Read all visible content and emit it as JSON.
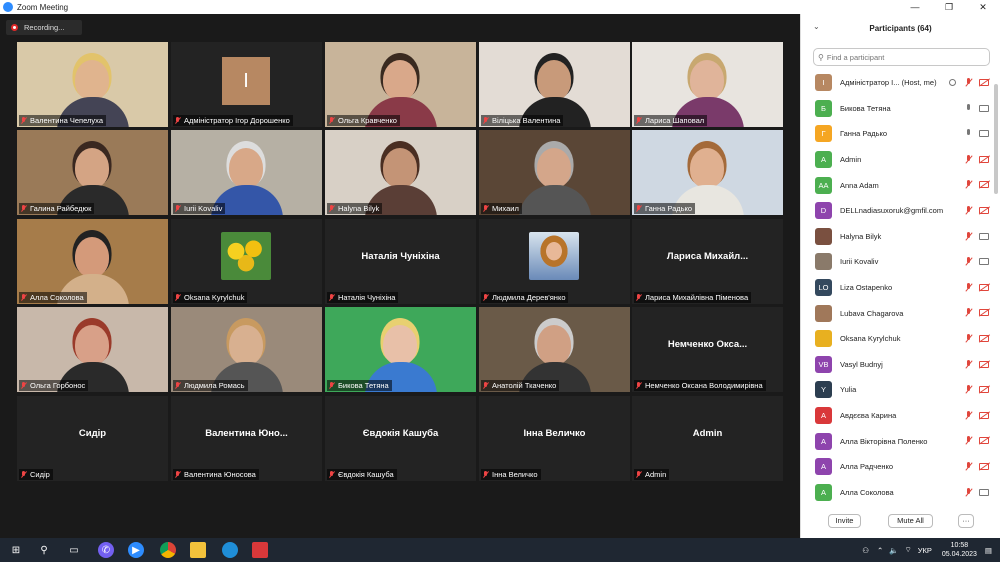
{
  "window": {
    "title": "Zoom Meeting",
    "controls": [
      "—",
      "❐",
      "✕"
    ]
  },
  "recording_label": "Recording...",
  "tiles": [
    {
      "name": "Валентина Чепелуха",
      "kind": "video",
      "bg": "#d9c9a8",
      "skin": "#e0b48e",
      "shirt": "#445",
      "hair": "#e2c36b",
      "active": false
    },
    {
      "name": "Адміністратор Ігор Дорошенко",
      "kind": "initial",
      "initial": "І",
      "active": false
    },
    {
      "name": "Ольга Кравченко",
      "kind": "video",
      "bg": "#c8b49a",
      "skin": "#d9a88a",
      "shirt": "#8a3a48",
      "hair": "#3a2a20",
      "active": false
    },
    {
      "name": "Віліцька Валентина",
      "kind": "video",
      "bg": "#e3dcd5",
      "skin": "#c89a7a",
      "shirt": "#222",
      "hair": "#222",
      "active": false
    },
    {
      "name": "Лариса Шаповал",
      "kind": "video",
      "bg": "#e8e4df",
      "skin": "#e0b49a",
      "shirt": "#7a3a6a",
      "hair": "#c8a870",
      "active": false
    },
    {
      "name": "Галина Райбедюк",
      "kind": "video",
      "bg": "#9a7a58",
      "skin": "#d4a484",
      "shirt": "#2a2a2a",
      "hair": "#3a2820",
      "active": false
    },
    {
      "name": "Iurii Kovaliv",
      "kind": "video",
      "bg": "#b6b0a4",
      "skin": "#d8a888",
      "shirt": "#3456a8",
      "hair": "#ddd",
      "active": false
    },
    {
      "name": "Halyna Bilyk",
      "kind": "video",
      "bg": "#d8d0c6",
      "skin": "#c49476",
      "shirt": "#5a3e36",
      "hair": "#4a2e22",
      "active": false
    },
    {
      "name": "Михаил",
      "kind": "video",
      "bg": "#5a4636",
      "skin": "#d4a68a",
      "shirt": "#555",
      "hair": "#aaa",
      "active": false
    },
    {
      "name": "Ганна Радько",
      "kind": "video",
      "bg": "#cfd8e2",
      "skin": "#e0b090",
      "shirt": "#e8e6e0",
      "hair": "#a46a3a",
      "active": true
    },
    {
      "name": "Алла Соколова",
      "kind": "video",
      "bg": "#a67c4a",
      "skin": "#d49a7a",
      "shirt": "#d3b08a",
      "hair": "#222",
      "active": false
    },
    {
      "name": "Oksana Kyrylchuk",
      "kind": "photo",
      "photo": "flowers",
      "active": false
    },
    {
      "name": "Наталія Чуніхіна",
      "kind": "name",
      "display": "Наталія Чуніхіна",
      "active": false
    },
    {
      "name": "Людмила Дерев'янко",
      "kind": "photo",
      "photo": "portrait",
      "active": false
    },
    {
      "name": "Лариса Михайлівна Піменова",
      "kind": "name",
      "display": "Лариса Михайл...",
      "active": false
    },
    {
      "name": "Ольга Горбонос",
      "kind": "video",
      "bg": "#c8b8aa",
      "skin": "#d8a088",
      "shirt": "#2a2a2a",
      "hair": "#9a3a2a",
      "active": false
    },
    {
      "name": "Людмила Ромась",
      "kind": "video",
      "bg": "#9a8a7a",
      "skin": "#d8b090",
      "shirt": "#555",
      "hair": "#c89a60",
      "active": false
    },
    {
      "name": "Бикова Тетяна",
      "kind": "video",
      "bg": "#3ea85a",
      "skin": "#e8c0a8",
      "shirt": "#3a7ad0",
      "hair": "#e8d070",
      "active": false
    },
    {
      "name": "Анатолій Ткаченко",
      "kind": "video",
      "bg": "#6a5a48",
      "skin": "#d0a084",
      "shirt": "#333",
      "hair": "#ccc",
      "active": false
    },
    {
      "name": "Немченко Оксана Володимирівна",
      "kind": "name",
      "display": "Немченко Окса...",
      "active": false
    },
    {
      "name": "Сидір",
      "kind": "name",
      "display": "Сидір",
      "active": false
    },
    {
      "name": "Валентина Юносова",
      "kind": "name",
      "display": "Валентина Юно...",
      "active": false
    },
    {
      "name": "Євдокія Кашуба",
      "kind": "name",
      "display": "Євдокія Кашуба",
      "active": false
    },
    {
      "name": "Інна Величко",
      "kind": "name",
      "display": "Інна Величко",
      "active": false
    },
    {
      "name": "Admin",
      "kind": "name",
      "display": "Admin",
      "active": false
    }
  ],
  "participants_panel": {
    "title": "Participants (64)",
    "search_placeholder": "Find a participant",
    "invite": "Invite",
    "mute_all": "Mute All",
    "more": "···",
    "participants": [
      {
        "initials": "І",
        "name": "Адміністратор І... (Host, me)",
        "color": "#b78862",
        "host": true,
        "mic": "muted",
        "cam": "off"
      },
      {
        "initials": "Б",
        "name": "Бикова Тетяна",
        "color": "#4caf50",
        "mic": "on",
        "cam": "on"
      },
      {
        "initials": "Г",
        "name": "Ганна Радько",
        "color": "#f5a623",
        "mic": "on",
        "cam": "on"
      },
      {
        "initials": "A",
        "name": "Admin",
        "color": "#4caf50",
        "mic": "muted",
        "cam": "off"
      },
      {
        "initials": "AA",
        "name": "Anna Adam",
        "color": "#4caf50",
        "mic": "muted",
        "cam": "off"
      },
      {
        "initials": "D",
        "name": "DELLnadiasuxoruk@gmfil.com",
        "color": "#8e44ad",
        "mic": "muted",
        "cam": "off"
      },
      {
        "initials": "",
        "name": "Halyna Bilyk",
        "color": "#7a5040",
        "mic": "muted",
        "cam": "on"
      },
      {
        "initials": "",
        "name": "Iurii Kovaliv",
        "color": "#8a7a6a",
        "mic": "muted",
        "cam": "on"
      },
      {
        "initials": "LO",
        "name": "Liza Ostapenko",
        "color": "#34495e",
        "mic": "muted",
        "cam": "off"
      },
      {
        "initials": "",
        "name": "Lubava Chagarova",
        "color": "#a0785a",
        "mic": "muted",
        "cam": "off"
      },
      {
        "initials": "",
        "name": "Oksana Kyrylchuk",
        "color": "#e8b020",
        "mic": "muted",
        "cam": "off"
      },
      {
        "initials": "VB",
        "name": "Vasyl Budnyj",
        "color": "#8e44ad",
        "mic": "muted",
        "cam": "off"
      },
      {
        "initials": "Y",
        "name": "Yulia",
        "color": "#2c3e50",
        "mic": "muted",
        "cam": "off"
      },
      {
        "initials": "А",
        "name": "Авдєєва Карина",
        "color": "#d9383a",
        "mic": "muted",
        "cam": "off"
      },
      {
        "initials": "А",
        "name": "Алла Вікторівна Поленко",
        "color": "#8e44ad",
        "mic": "muted",
        "cam": "off"
      },
      {
        "initials": "А",
        "name": "Алла Радченко",
        "color": "#8e44ad",
        "mic": "muted",
        "cam": "off"
      },
      {
        "initials": "А",
        "name": "Алла Соколова",
        "color": "#4caf50",
        "mic": "muted",
        "cam": "on"
      }
    ]
  },
  "taskbar": {
    "apps": [
      "windows-start-icon",
      "search-icon",
      "task-view-icon",
      "viber-icon",
      "zoom-icon",
      "chrome-icon",
      "file-explorer-icon",
      "edge-icon",
      "pdf-reader-icon"
    ],
    "lang": "УКР",
    "time": "10:58",
    "date": "05.04.2023"
  },
  "colors": {
    "accent": "#2d8cff",
    "active_speaker": "#a6d33b",
    "muted_red": "#e0463c"
  }
}
